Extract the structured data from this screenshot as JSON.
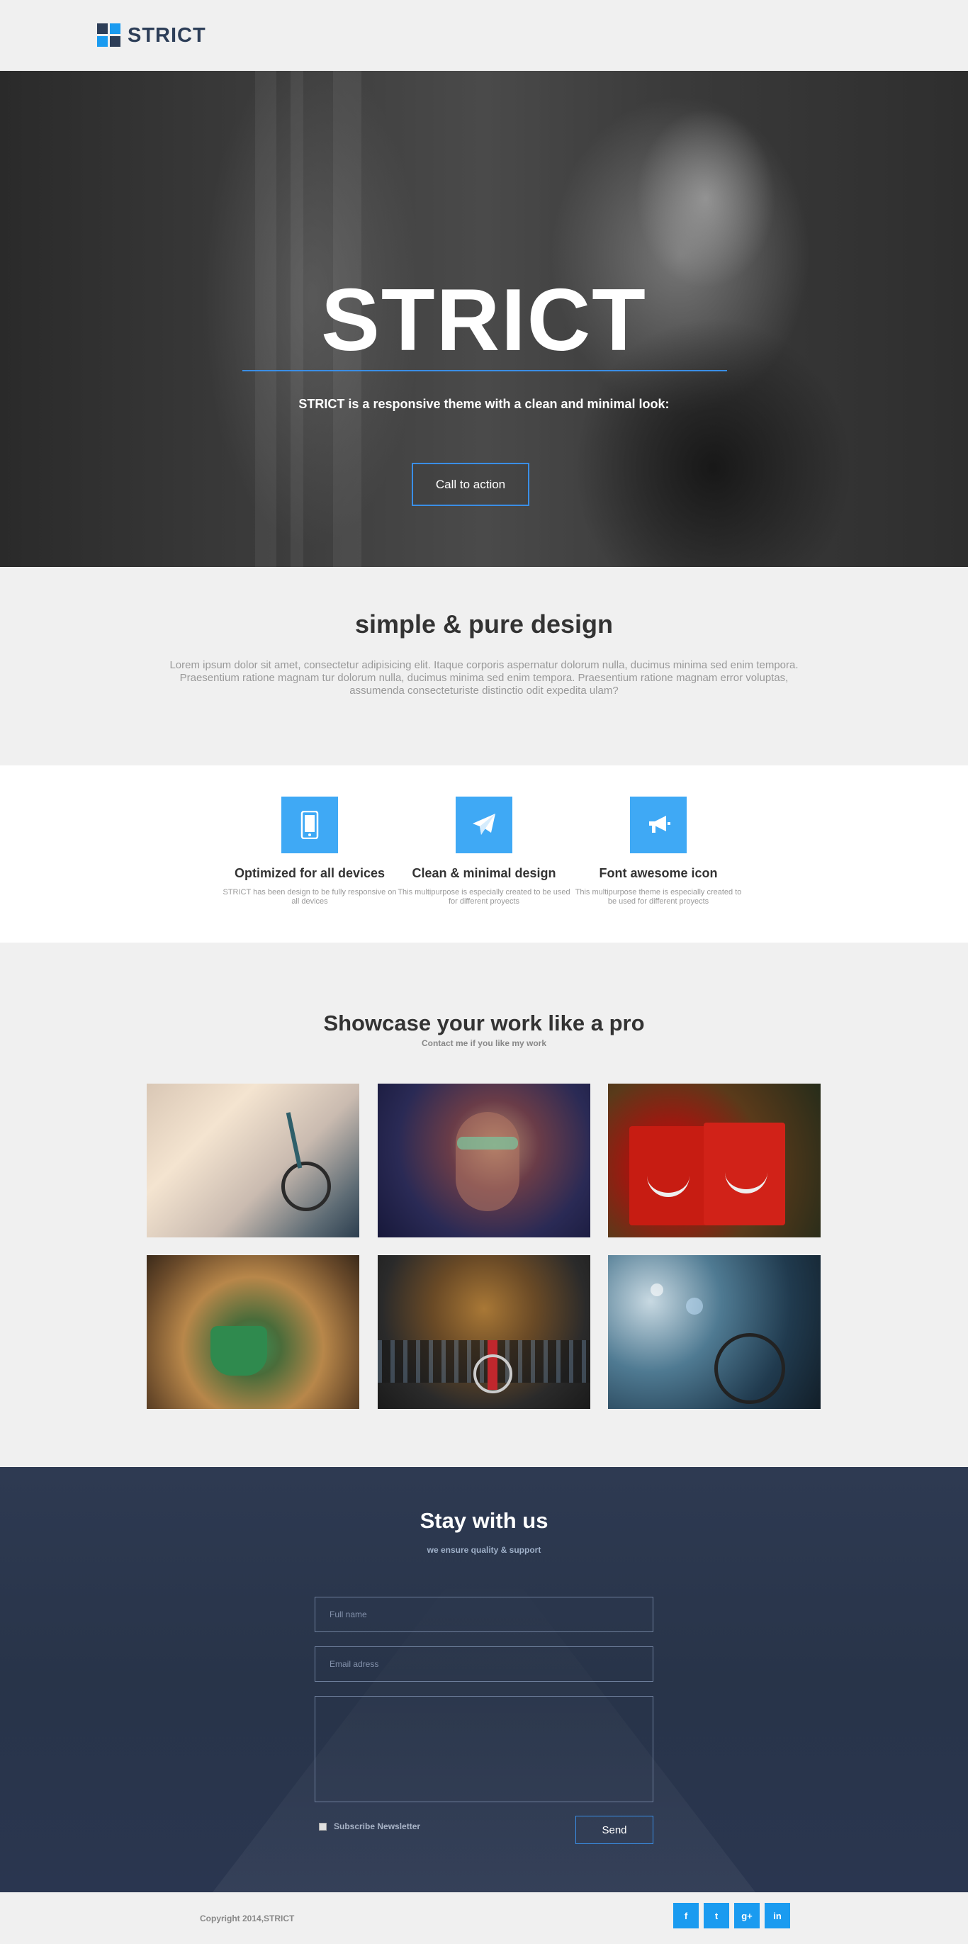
{
  "brand": {
    "name": "STRICT",
    "accent": "#1a9bf0",
    "dark": "#2d3e58"
  },
  "hero": {
    "title": "STRICT",
    "subtitle": "STRICT is a responsive theme with a clean and minimal look:",
    "cta_label": "Call to action"
  },
  "intro": {
    "title": "simple & pure design",
    "body": "Lorem ipsum dolor sit amet, consectetur adipisicing elit. Itaque corporis aspernatur dolorum nulla, ducimus minima sed enim tempora. Praesentium ratione magnam tur dolorum nulla, ducimus minima sed enim tempora. Praesentium ratione magnam error voluptas, assumenda consecteturiste distinctio odit expedita ulam?"
  },
  "features": [
    {
      "icon": "mobile-icon",
      "title": "Optimized for all devices",
      "text": "STRICT has been design to be fully responsive on all devices"
    },
    {
      "icon": "paper-plane-icon",
      "title": "Clean & minimal design",
      "text": "This multipurpose is especially created to be used for different proyects"
    },
    {
      "icon": "bullhorn-icon",
      "title": "Font awesome icon",
      "text": "This multipurpose theme is especially created to be used for different proyects"
    }
  ],
  "showcase": {
    "title": "Showcase your work like a pro",
    "subtitle": "Contact me if you like my work"
  },
  "contact": {
    "title": "Stay with us",
    "subtitle": "we ensure quality & support",
    "name_placeholder": "Full name",
    "email_placeholder": "Email adress",
    "subscribe_label": "Subscribe Newsletter",
    "send_label": "Send"
  },
  "footer": {
    "copyright": "Copyright 2014,STRICT",
    "social": [
      {
        "icon": "facebook-icon",
        "glyph": "f"
      },
      {
        "icon": "twitter-icon",
        "glyph": "t"
      },
      {
        "icon": "google-plus-icon",
        "glyph": "g+"
      },
      {
        "icon": "linkedin-icon",
        "glyph": "in"
      }
    ]
  }
}
